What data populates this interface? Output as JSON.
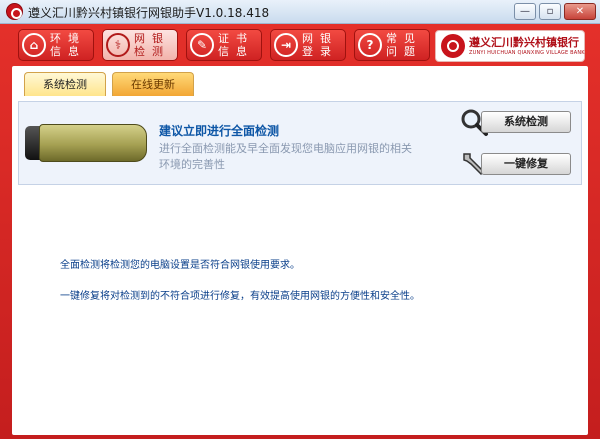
{
  "window": {
    "title": "遵义汇川黔兴村镇银行网银助手V1.0.18.418",
    "minimize": "—",
    "restore": "▫",
    "close": "✕"
  },
  "nav": {
    "items": [
      {
        "label": "环境信息",
        "icon": "home-icon",
        "active": false
      },
      {
        "label": "网银检测",
        "icon": "stethoscope-icon",
        "active": true
      },
      {
        "label": "证书信息",
        "icon": "certificate-icon",
        "active": false
      },
      {
        "label": "网银登录",
        "icon": "login-icon",
        "active": false
      },
      {
        "label": "常见问题",
        "icon": "question-icon",
        "active": false
      }
    ]
  },
  "bank": {
    "name_cn": "遵义汇川黔兴村镇银行",
    "name_en": "ZUNYI HUICHUAN QIANXING VILLAGE BANK"
  },
  "tabs": [
    {
      "label": "系统检测",
      "active": true
    },
    {
      "label": "在线更新",
      "active": false
    }
  ],
  "panel": {
    "title": "建议立即进行全面检测",
    "description": "进行全面检测能及早全面发现您电脑应用网银的相关环境的完善性",
    "check_button": "系统检测",
    "repair_button": "一键修复"
  },
  "info": {
    "line1": "全面检测将检测您的电脑设置是否符合网银使用要求。",
    "line2": "一键修复将对检测到的不符合项进行修复，有效提高使用网银的方便性和安全性。"
  },
  "colors": {
    "brand_red": "#c8141c",
    "link_blue": "#0d56a6"
  }
}
